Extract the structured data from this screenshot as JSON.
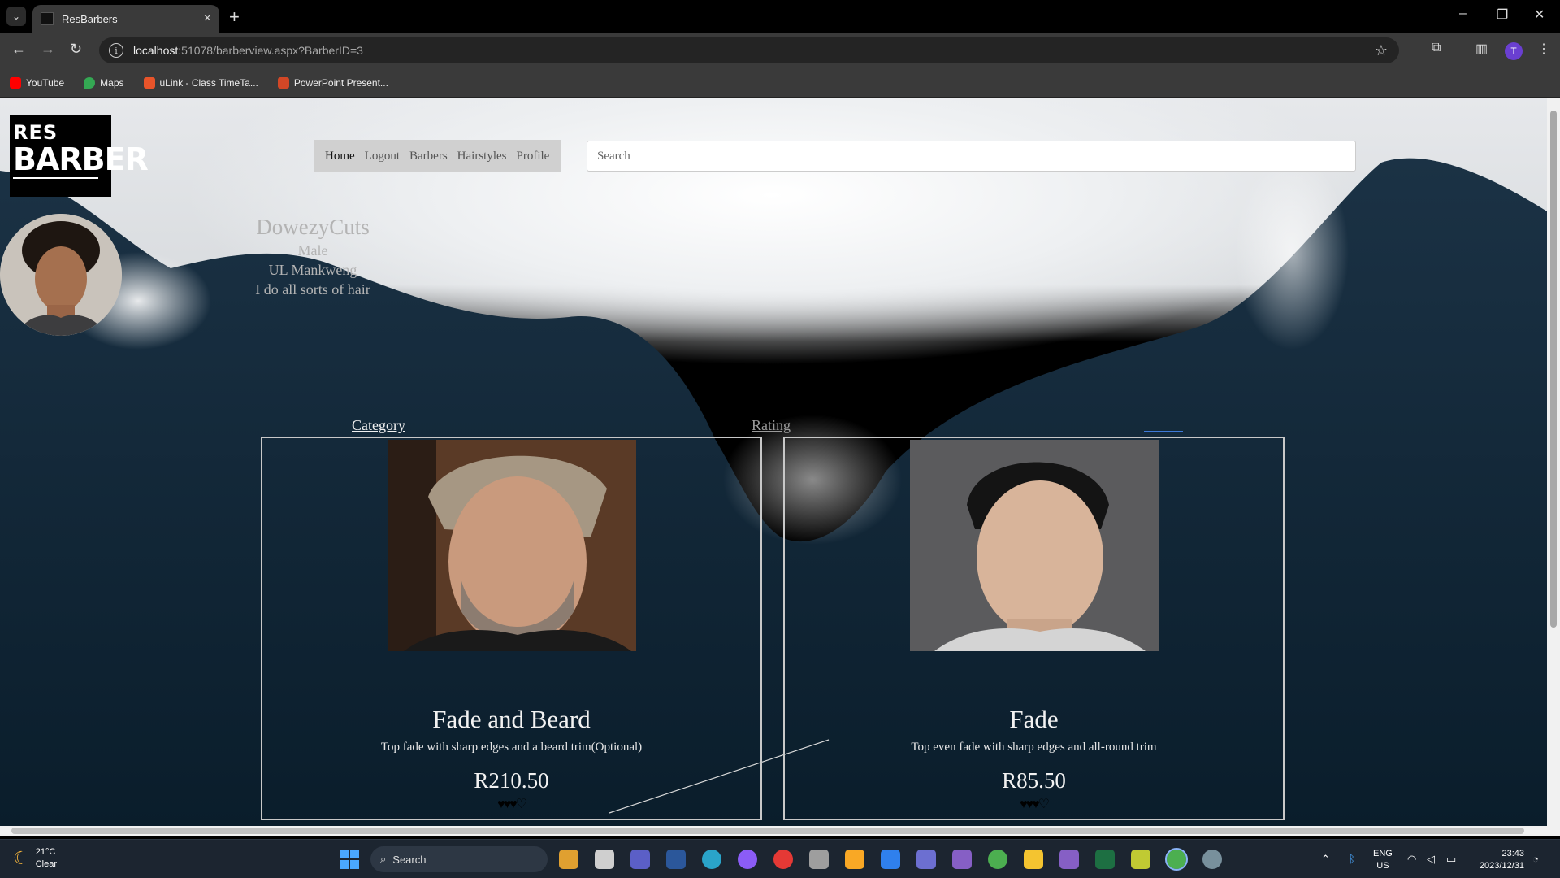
{
  "browser": {
    "tab_title": "ResBarbers",
    "url_host": "localhost",
    "url_rest": ":51078/barberview.aspx?BarberID=3",
    "bookmarks": [
      {
        "label": "YouTube",
        "icon": "youtube-icon",
        "color": "#ff0000"
      },
      {
        "label": "Maps",
        "icon": "maps-pin-icon",
        "color": "#34a853"
      },
      {
        "label": "uLink - Class TimeTa...",
        "icon": "ulink-icon",
        "color": "#e8542a"
      },
      {
        "label": "PowerPoint Present...",
        "icon": "powerpoint-icon",
        "color": "#d24726"
      }
    ],
    "profile_initial": "T"
  },
  "site": {
    "logo": {
      "line1": "RES",
      "line2": "BARBER"
    },
    "nav": [
      "Home",
      "Logout",
      "Barbers",
      "Hairstyles",
      "Profile"
    ],
    "search_placeholder": "Search",
    "barber": {
      "name": "DowezyCuts",
      "gender": "Male",
      "location": "UL Mankweng",
      "bio": "I do all sorts of hair"
    },
    "columns": {
      "category": "Category",
      "rating": "Rating"
    },
    "cards": [
      {
        "title": "Fade and Beard",
        "description": "Top fade with sharp edges and a beard trim(Optional)",
        "price": "R210.50",
        "rating_out_of_4": 3.5
      },
      {
        "title": "Fade",
        "description": "Top even fade with sharp edges and all-round trim",
        "price": "R85.50",
        "rating_out_of_4": 3.5
      }
    ]
  },
  "taskbar": {
    "temp": "21°C",
    "condition": "Clear",
    "search_label": "Search",
    "lang_line1": "ENG",
    "lang_line2": "US",
    "time": "23:43",
    "date": "2023/12/31"
  },
  "colors": {
    "accent_blue": "#3d79d8",
    "ocean_dark": "#0c2233"
  }
}
